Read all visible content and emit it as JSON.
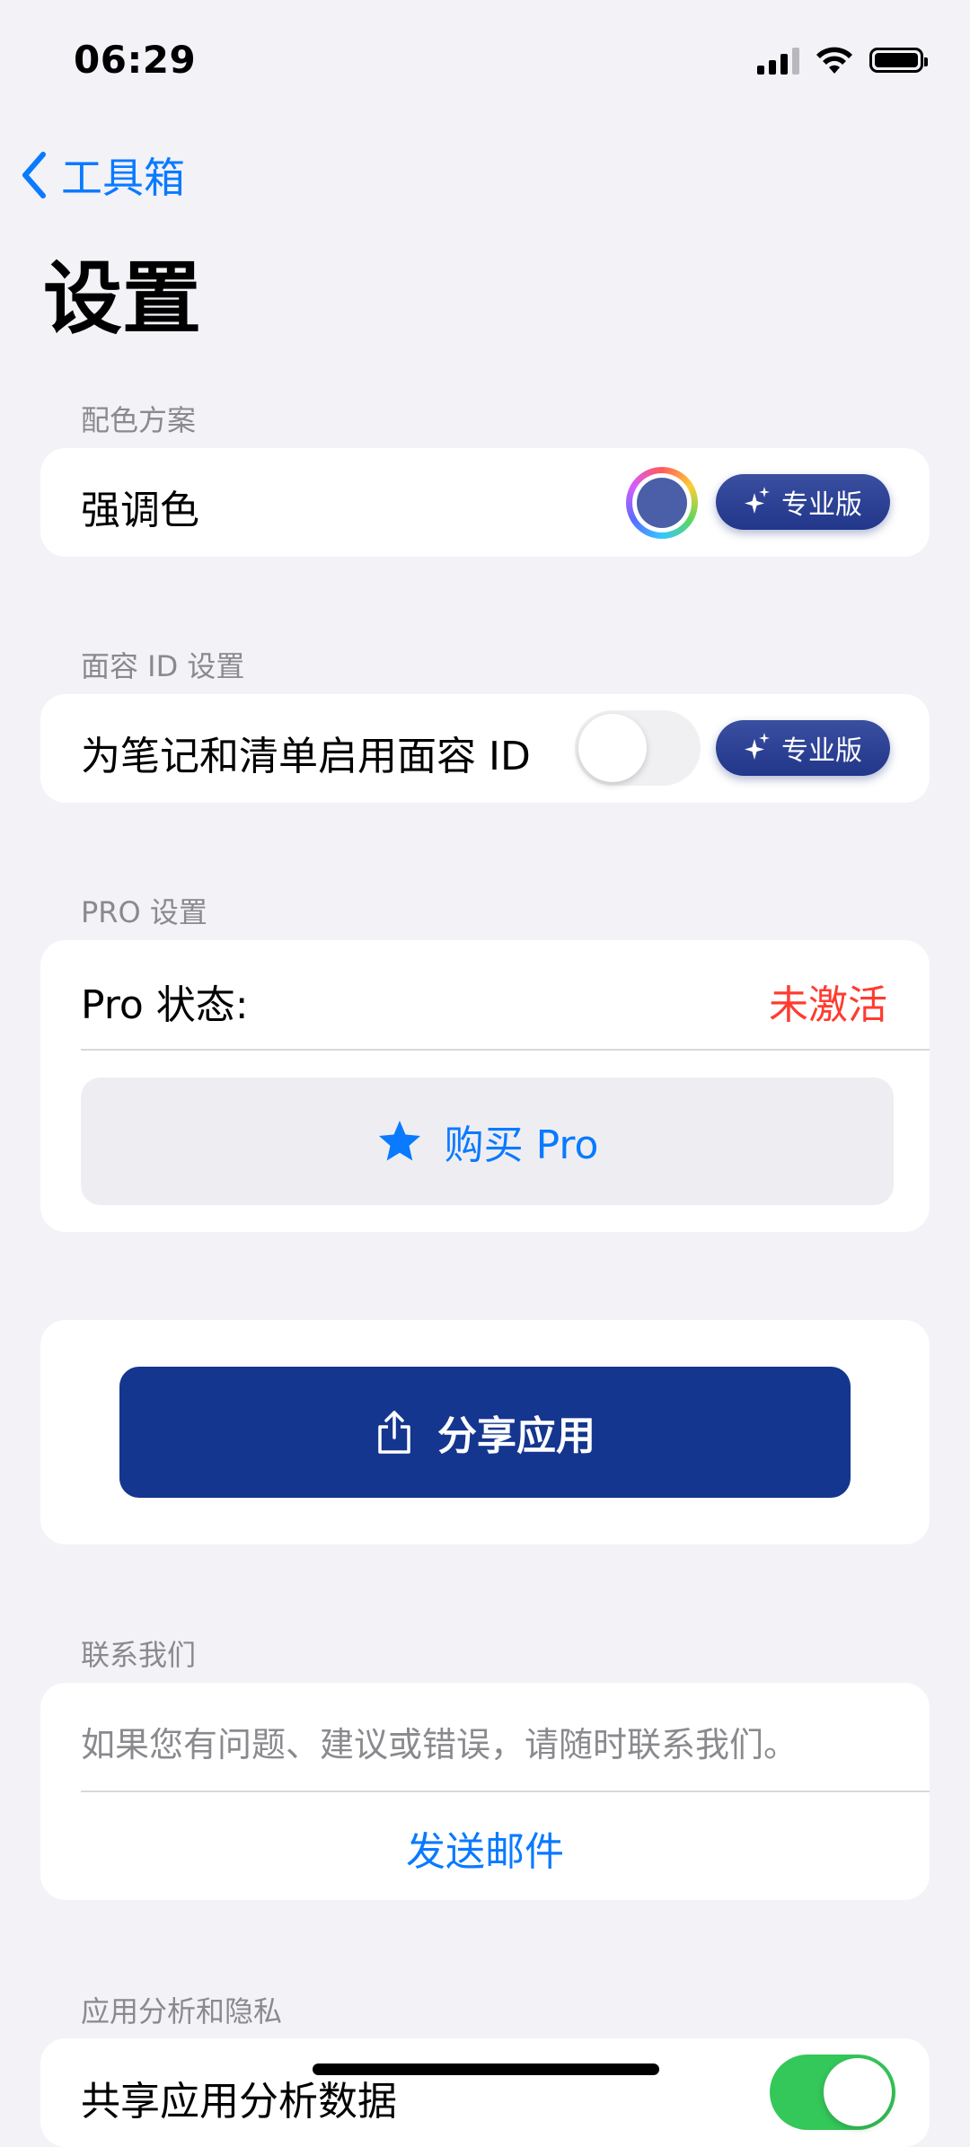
{
  "status_bar": {
    "time": "06:29"
  },
  "nav": {
    "back_label": "工具箱",
    "title": "设置"
  },
  "sections": {
    "color_scheme": {
      "header": "配色方案",
      "accent_label": "强调色",
      "accent_color": "#4a5fa8",
      "pro_badge": "专业版"
    },
    "face_id": {
      "header": "面容 ID 设置",
      "toggle_label": "为笔记和清单启用面容 ID",
      "toggle_on": false,
      "pro_badge": "专业版"
    },
    "pro": {
      "header": "PRO 设置",
      "status_label": "Pro 状态:",
      "status_value": "未激活",
      "status_color": "#ff3b30",
      "buy_label": "购买 Pro"
    },
    "share": {
      "button_label": "分享应用"
    },
    "contact": {
      "header": "联系我们",
      "description": "如果您有问题、建议或错误，请随时联系我们。",
      "send_email": "发送邮件"
    },
    "analytics": {
      "header": "应用分析和隐私",
      "share_label": "共享应用分析数据",
      "toggle_on": true
    }
  },
  "colors": {
    "accent_blue": "#0a7aff",
    "share_button": "#14368f",
    "background": "#f2f2f7"
  }
}
